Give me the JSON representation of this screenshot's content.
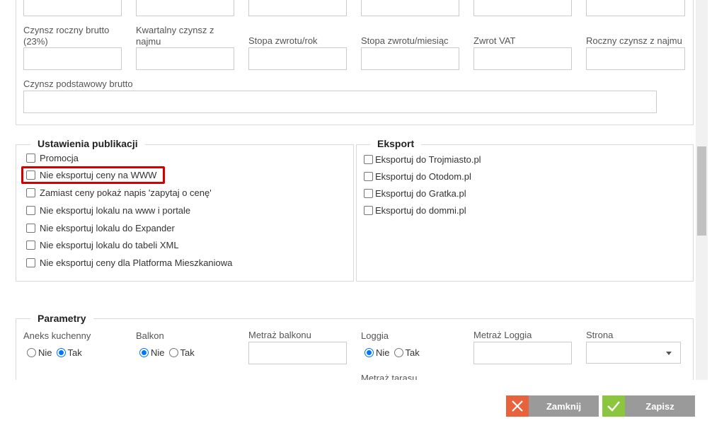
{
  "top_fields": {
    "row2": [
      {
        "label": "Czynsz roczny brutto (23%)"
      },
      {
        "label": "Kwartalny czynsz z najmu"
      },
      {
        "label": "Stopa zwrotu/rok"
      },
      {
        "label": "Stopa zwrotu/miesiąc"
      },
      {
        "label": "Zwrot VAT"
      },
      {
        "label": "Roczny czynsz z najmu"
      }
    ],
    "row3": {
      "label": "Czynsz podstawowy brutto"
    }
  },
  "publication": {
    "title": "Ustawienia publikacji",
    "items": [
      {
        "label": "Promocja",
        "checked": false
      },
      {
        "label": "Nie eksportuj ceny na WWW",
        "checked": false
      },
      {
        "label": "Zamiast ceny pokaż napis 'zapytaj o cenę'",
        "checked": false
      },
      {
        "label": "Nie eksportuj lokalu na www i portale",
        "checked": false
      },
      {
        "label": "Nie eksportuj lokalu do Expander",
        "checked": false
      },
      {
        "label": "Nie eksportuj lokalu do tabeli XML",
        "checked": false
      },
      {
        "label": "Nie eksportuj ceny dla Platforma Mieszkaniowa",
        "checked": false
      }
    ]
  },
  "export": {
    "title": "Eksport",
    "items": [
      {
        "label": "Eksportuj do Trojmiasto.pl",
        "checked": false
      },
      {
        "label": "Eksportuj do Otodom.pl",
        "checked": false
      },
      {
        "label": "Eksportuj do Gratka.pl",
        "checked": false
      },
      {
        "label": "Eksportuj do dommi.pl",
        "checked": false
      }
    ]
  },
  "parameters": {
    "title": "Parametry",
    "aneks": {
      "label": "Aneks kuchenny",
      "options": [
        "Nie",
        "Tak"
      ],
      "selected": "Tak"
    },
    "balkon": {
      "label": "Balkon",
      "options": [
        "Nie",
        "Tak"
      ],
      "selected": "Nie"
    },
    "metraz_balkonu": {
      "label": "Metraż balkonu"
    },
    "loggia": {
      "label": "Loggia",
      "options": [
        "Nie",
        "Tak"
      ],
      "selected": "Nie"
    },
    "metraz_loggia": {
      "label": "Metraż Loggia"
    },
    "strona": {
      "label": "Strona",
      "value": ""
    },
    "metraz_tarasu": {
      "label": "Metraż tarasu"
    }
  },
  "footer": {
    "close_label": "Zamknij",
    "save_label": "Zapisz",
    "close_color": "#e8623b",
    "save_color": "#8cc63f"
  }
}
